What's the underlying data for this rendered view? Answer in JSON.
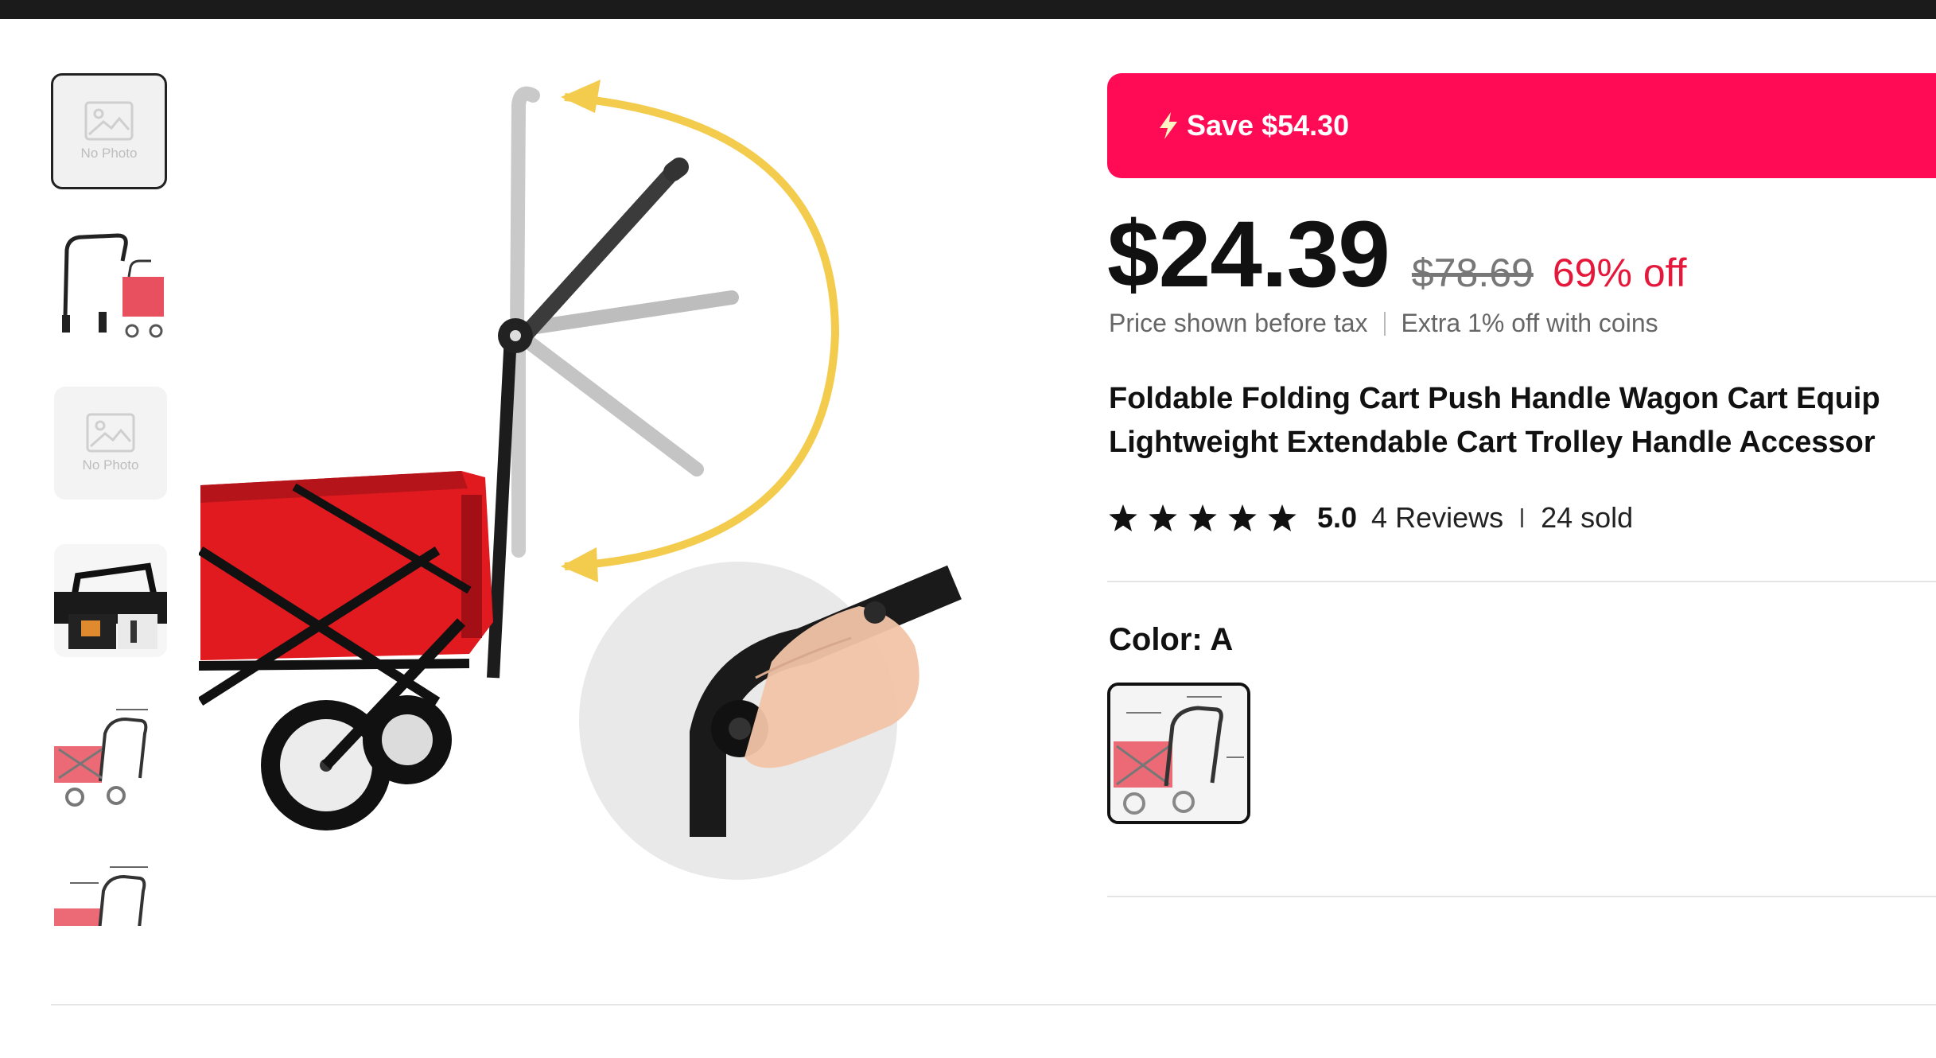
{
  "product": {
    "save_text": "Save $54.30",
    "price_current": "$24.39",
    "price_original": "$78.69",
    "price_discount": "69% off",
    "tax_note": "Price shown before tax",
    "coins_note": "Extra 1% off with coins",
    "title_line1": "Foldable Folding Cart Push Handle Wagon Cart Equip",
    "title_line2": "Lightweight Extendable Cart Trolley Handle Accessor",
    "rating_value": "5.0",
    "rating_stars": 5,
    "reviews": "4 Reviews",
    "sold": "24 sold",
    "color_label": "Color: A"
  },
  "gallery": {
    "thumbnails": [
      {
        "type": "no-photo",
        "label": "No Photo",
        "selected": true
      },
      {
        "type": "cart-handle-parts",
        "selected": false
      },
      {
        "type": "no-photo",
        "label": "No Photo",
        "selected": false
      },
      {
        "type": "cart-closeup",
        "selected": false
      },
      {
        "type": "cart-dimensions",
        "selected": false
      },
      {
        "type": "cart-dimensions-2",
        "selected": false
      }
    ]
  },
  "colors": {
    "accent": "#ff0a54",
    "discount": "#e5183b",
    "arrow": "#f3cc4e",
    "cart_red": "#e01a1f"
  }
}
